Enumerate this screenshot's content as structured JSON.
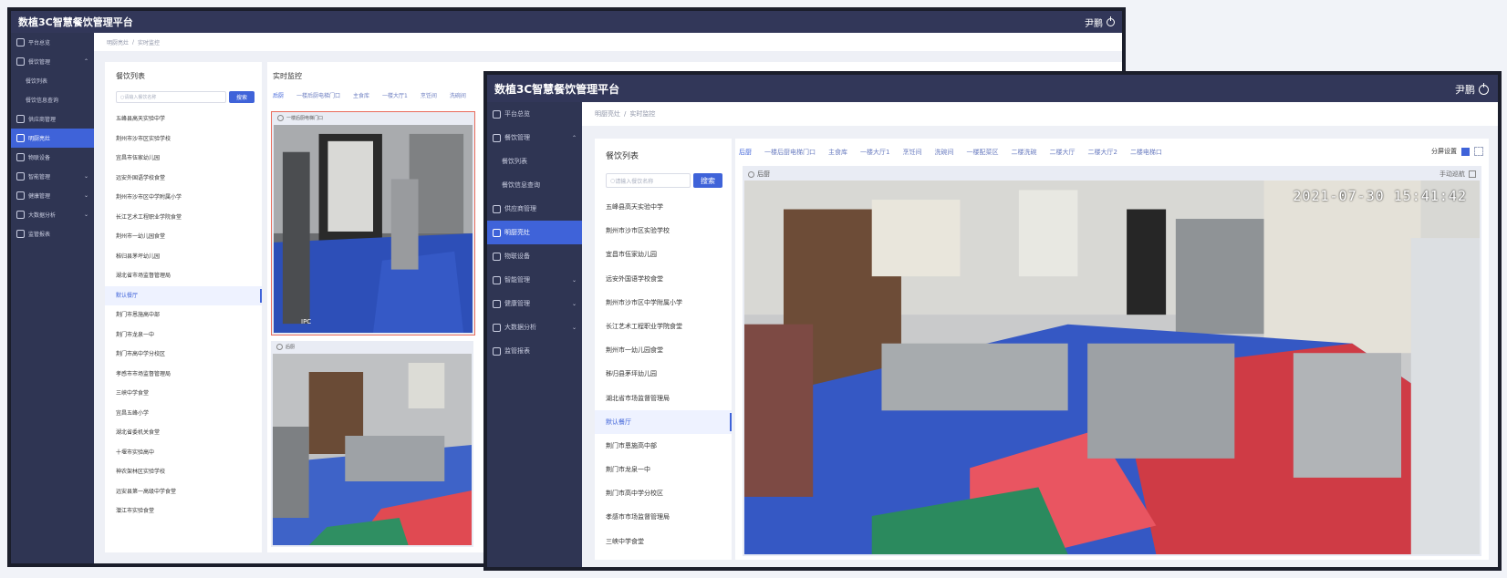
{
  "app": {
    "title": "数植3C智慧餐饮管理平台",
    "user": "尹鹏"
  },
  "sidebar": {
    "items": [
      {
        "label": "平台总览"
      },
      {
        "label": "餐饮管理"
      },
      {
        "label": "餐饮列表"
      },
      {
        "label": "餐饮信息查询"
      },
      {
        "label": "供应商管理"
      },
      {
        "label": "明厨亮灶"
      },
      {
        "label": "物联设备"
      },
      {
        "label": "智能管理"
      },
      {
        "label": "健康管理"
      },
      {
        "label": "大数据分析"
      },
      {
        "label": "监管报表"
      }
    ]
  },
  "breadcrumb": {
    "home": "明厨亮灶",
    "sep": "/",
    "current": "实时监控"
  },
  "restaurants": {
    "title": "餐饮列表",
    "search_placeholder": "请输入餐饮名称",
    "search_button": "搜索",
    "items": [
      "五峰县高天实验中学",
      "荆州市沙市区实验学校",
      "宜昌市伍家幼儿园",
      "远安外国语学校食堂",
      "荆州市沙市区中学附属小学",
      "长江艺术工程职业学院食堂",
      "荆州市一幼儿园食堂",
      "秭归县茅坪幼儿园",
      "湖北省市场监督管理局",
      "默认餐厅",
      "荆门市恩施高中部",
      "荆门市龙泉一中",
      "荆门市高中学分校区",
      "孝感市市场监督管理局",
      "三峡中学食堂",
      "宜昌五峰小学",
      "湖北省委机关食堂",
      "十堰市实验高中",
      "神农架林区实验学校",
      "远安县第一高级中学食堂",
      "潜江市实验食堂"
    ],
    "selected_index": 9
  },
  "monitor": {
    "title": "实时监控",
    "tabs": [
      "后厨",
      "一楼后厨电梯门口",
      "主食库",
      "一楼大厅1",
      "烹饪间",
      "洗碗间",
      "一楼配菜区",
      "二楼洗碗",
      "二楼大厅",
      "二楼大厅2",
      "二楼电梯口"
    ],
    "tools_label": "分屏设置",
    "feeds": [
      {
        "label": "一楼后厨电梯门口",
        "overlay": "IPC"
      },
      {
        "label": "后厨"
      }
    ],
    "zoom_feed": {
      "label": "后厨",
      "control": "手动巡航",
      "timestamp": "2021-07-30 15:41:42"
    }
  },
  "colors": {
    "topbar": "#323759",
    "sidebar": "#2f3553",
    "accent": "#3f63d9"
  }
}
